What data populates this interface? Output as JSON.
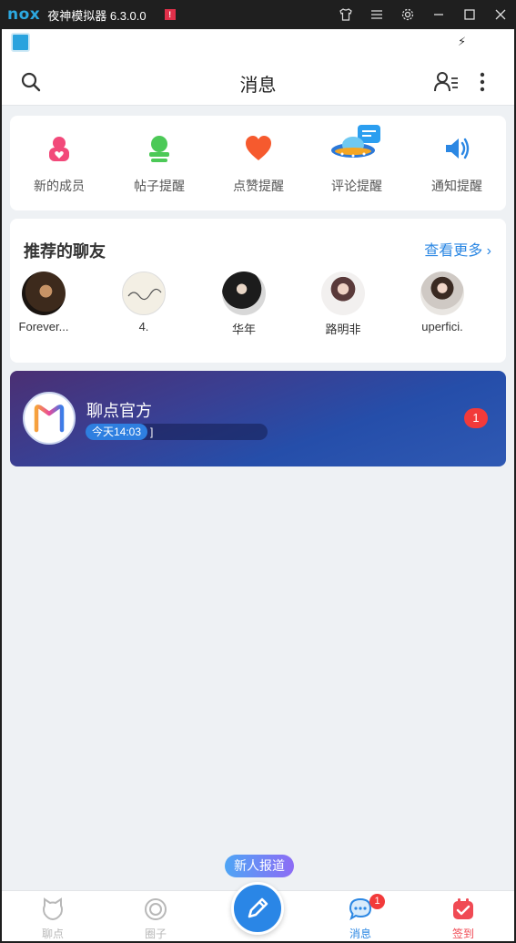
{
  "emulator": {
    "logo": "nox",
    "title": "夜神模拟器 6.3.0.0",
    "warning": "!"
  },
  "header": {
    "title": "消息"
  },
  "quick_actions": [
    {
      "label": "新的成员",
      "icon": "new-member-icon",
      "color": "#f2497a"
    },
    {
      "label": "帖子提醒",
      "icon": "post-reminder-icon",
      "color": "#4cc957"
    },
    {
      "label": "点赞提醒",
      "icon": "like-reminder-icon",
      "color": "#f65a2e"
    },
    {
      "label": "评论提醒",
      "icon": "comment-reminder-icon",
      "color": "#2b9ef0"
    },
    {
      "label": "通知提醒",
      "icon": "notice-reminder-icon",
      "color": "#2b87e3"
    }
  ],
  "recommended": {
    "title": "推荐的聊友",
    "more": "查看更多",
    "friends": [
      {
        "name": "Forever..."
      },
      {
        "name": "4."
      },
      {
        "name": "华年"
      },
      {
        "name": "路明非"
      },
      {
        "name": "uperfici."
      }
    ]
  },
  "official": {
    "name": "聊点官方",
    "time": "今天14:03",
    "snippet": "]",
    "unread": "1"
  },
  "tooltip": "新人报道",
  "tabs": [
    {
      "label": "聊点",
      "icon": "cat-face-icon"
    },
    {
      "label": "圈子",
      "icon": "circle-icon"
    },
    {
      "label": "消息",
      "icon": "chat-bubble-icon",
      "badge": "1"
    },
    {
      "label": "签到",
      "icon": "checkin-icon"
    }
  ],
  "colors": {
    "accent": "#2b87e3",
    "badge": "#f23a3a",
    "background": "#eef1f4"
  }
}
